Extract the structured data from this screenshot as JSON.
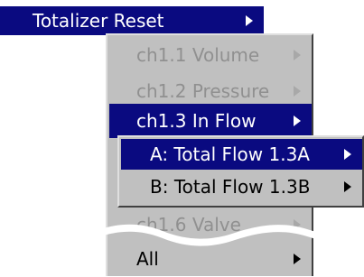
{
  "root_menu": {
    "label": "Totalizer Reset"
  },
  "submenu": {
    "items": [
      {
        "label": "ch1.1 Volume",
        "state": "disabled"
      },
      {
        "label": "ch1.2 Pressure",
        "state": "disabled"
      },
      {
        "label": "ch1.3 In Flow",
        "state": "selected"
      },
      {
        "label": "ch1.6 Valve",
        "state": "disabled"
      },
      {
        "label": "All",
        "state": "normal"
      }
    ]
  },
  "flow_submenu": {
    "items": [
      {
        "label": "A: Total Flow 1.3A",
        "state": "selected"
      },
      {
        "label": "B: Total Flow 1.3B",
        "state": "normal"
      }
    ]
  },
  "colors": {
    "highlight": "#0a0a80",
    "menu_bg": "#c0c0c0",
    "disabled_text": "#909090"
  },
  "icons": {
    "submenu_arrow": "triangle-right-icon",
    "break_marker": "wavy-break-icon"
  }
}
